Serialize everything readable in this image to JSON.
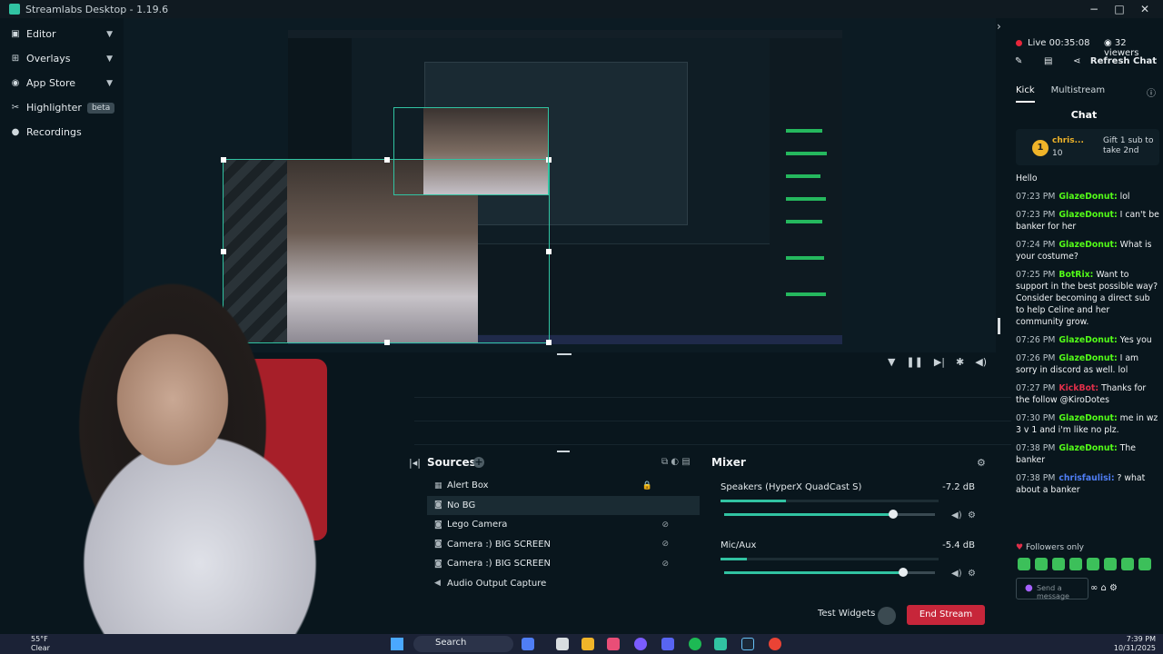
{
  "app": {
    "title": "Streamlabs Desktop - 1.19.6"
  },
  "window_controls": [
    "−",
    "□",
    "✕"
  ],
  "nav": [
    {
      "label": "Editor",
      "icon": "editor-icon",
      "chevron": true
    },
    {
      "label": "Overlays",
      "icon": "overlays-icon",
      "chevron": true
    },
    {
      "label": "App Store",
      "icon": "app-store-icon",
      "chevron": true
    },
    {
      "label": "Highlighter",
      "icon": "highlighter-icon",
      "badge": "beta"
    },
    {
      "label": "Recordings",
      "icon": "recordings-icon"
    }
  ],
  "sources": {
    "header": "Sources",
    "items": [
      "Alert Box",
      "No BG",
      "Lego Camera",
      "Camera :) BIG SCREEN",
      "Camera :) BIG SCREEN",
      "Audio Output Capture"
    ]
  },
  "mixer": {
    "header": "Mixer",
    "channels": [
      {
        "name": "Speakers (HyperX QuadCast S)",
        "db": "-7.2 dB",
        "level": 0.3,
        "fader": 0.8
      },
      {
        "name": "Mic/Aux",
        "db": "-5.4 dB",
        "level": 0.12,
        "fader": 0.85
      }
    ]
  },
  "footer": {
    "test_widgets": "Test Widgets",
    "end_stream": "End Stream"
  },
  "chat": {
    "live": "Live 00:35:08",
    "viewers": "32 viewers",
    "refresh": "Refresh Chat",
    "tabs": [
      "Kick",
      "Multistream"
    ],
    "header": "Chat",
    "pinned": {
      "rank": "1",
      "user": "chris...",
      "count": "10",
      "text": "Gift 1 sub to take 2nd"
    },
    "messages": [
      {
        "time": "",
        "user": "",
        "text": "Hello"
      },
      {
        "time": "07:23 PM",
        "user": "GlazeDonut:",
        "text": "lol"
      },
      {
        "time": "07:23 PM",
        "user": "GlazeDonut:",
        "text": "I can't be banker for her"
      },
      {
        "time": "07:24 PM",
        "user": "GlazeDonut:",
        "text": "What is your costume?"
      },
      {
        "time": "07:25 PM",
        "user": "BotRix:",
        "text": "Want to support in the best possible way? Consider becoming a direct sub to help Celine and her community grow."
      },
      {
        "time": "07:26 PM",
        "user": "GlazeDonut:",
        "text": "Yes you"
      },
      {
        "time": "07:26 PM",
        "user": "GlazeDonut:",
        "text": "I am sorry in discord as well. lol"
      },
      {
        "time": "07:27 PM",
        "user": "KickBot:",
        "text": "Thanks for the follow @KiroDotes"
      },
      {
        "time": "07:30 PM",
        "user": "GlazeDonut:",
        "text": "me in wz 3 v 1 and i'm like no plz."
      },
      {
        "time": "07:38 PM",
        "user": "GlazeDonut:",
        "text": "The banker"
      },
      {
        "time": "07:38 PM",
        "user": "chrisfaulisi:",
        "text": "? what about a banker"
      }
    ],
    "followers_only": "Followers only",
    "send_placeholder": "Send a message"
  },
  "taskbar": {
    "weather_temp": "55°F",
    "weather_cond": "Clear",
    "search": "Search",
    "time": "7:39 PM",
    "date": "10/31/2025"
  },
  "colors": {
    "accent": "#31c3a2",
    "end_stream": "#c7263a",
    "kick_green": "#53fc18"
  }
}
